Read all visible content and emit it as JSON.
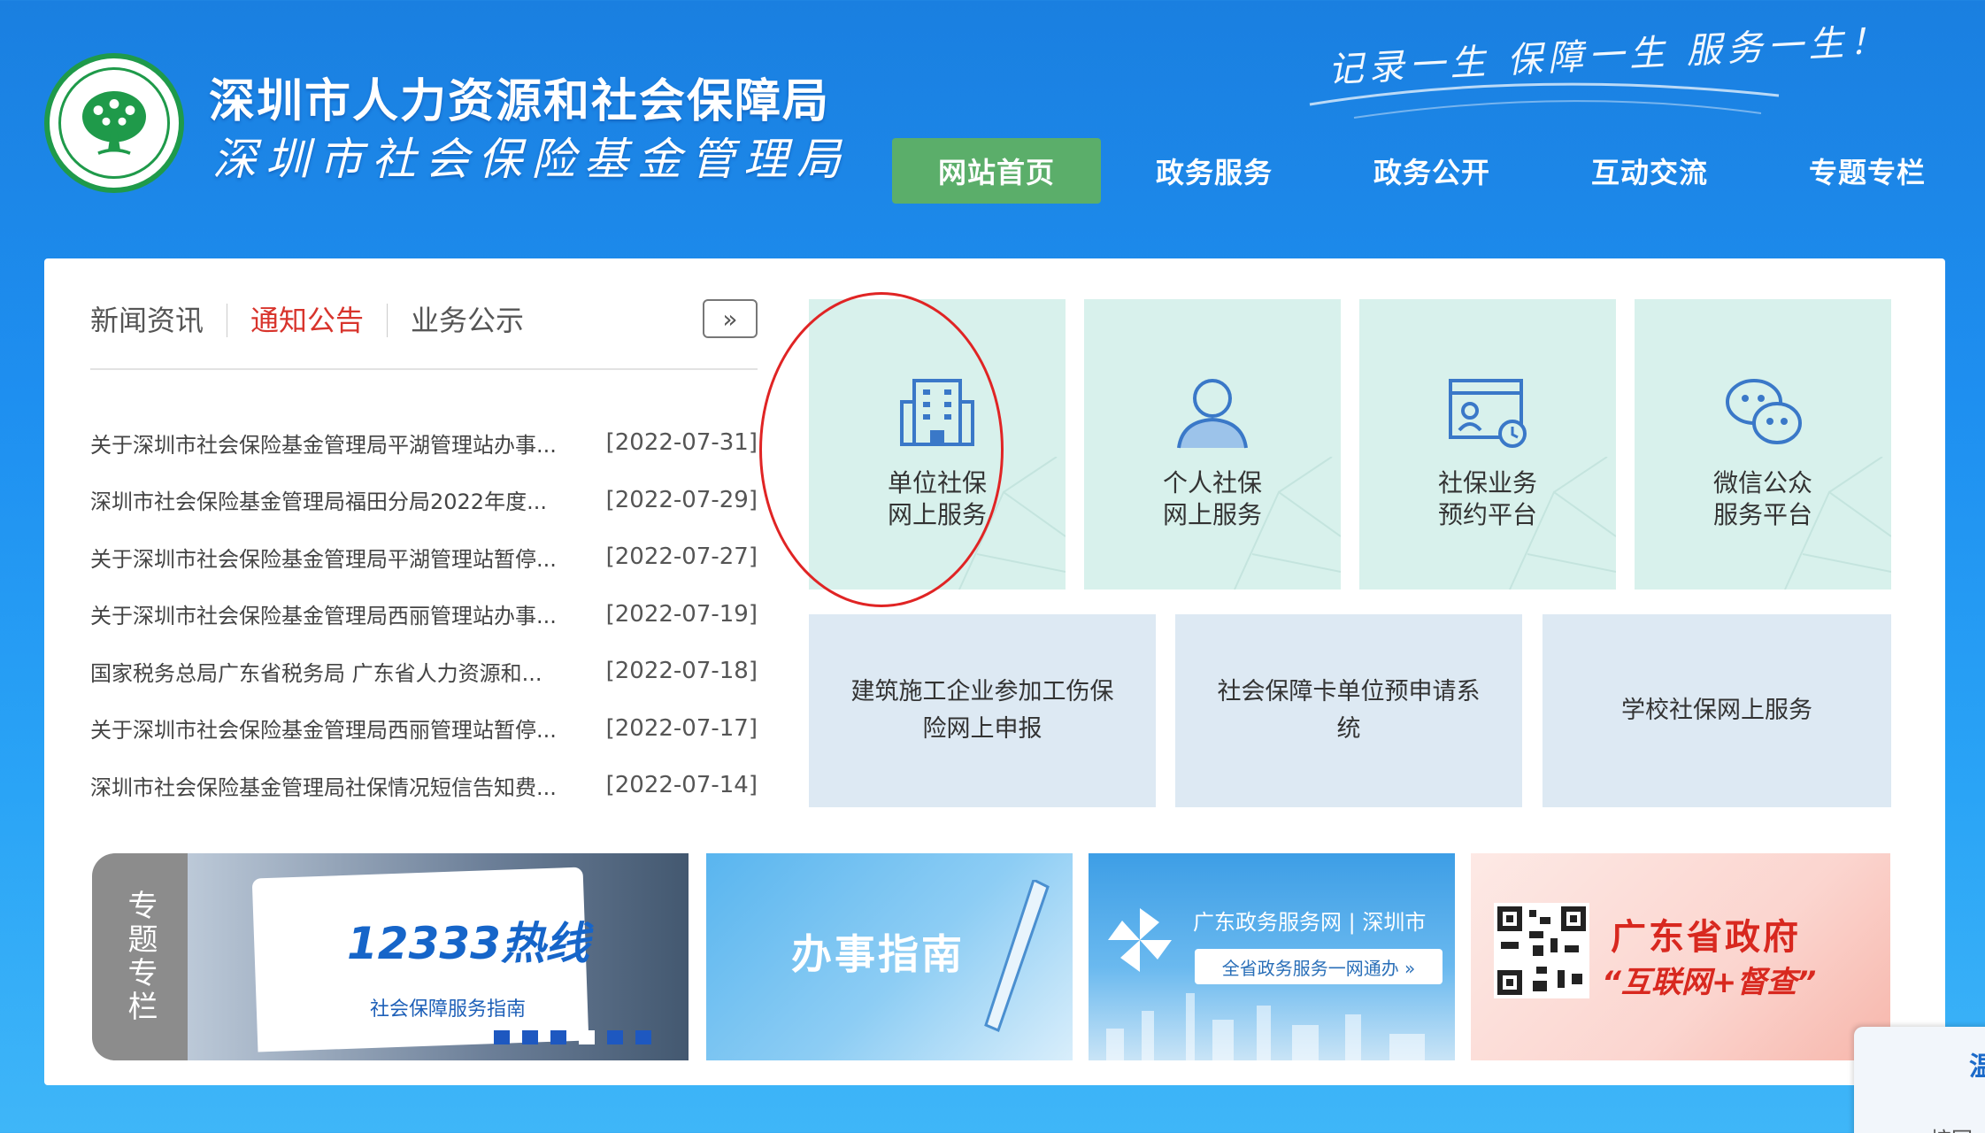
{
  "header": {
    "org_name_1": "深圳市人力资源和社会保障局",
    "org_name_2": "深圳市社会保险基金管理局",
    "slogan": "记录一生 保障一生 服务一生！",
    "logo_icon": "tree-emblem-icon"
  },
  "nav": [
    {
      "label": "网站首页",
      "active": true
    },
    {
      "label": "政务服务"
    },
    {
      "label": "政务公开"
    },
    {
      "label": "互动交流"
    },
    {
      "label": "专题专栏"
    }
  ],
  "news_tabs": [
    {
      "label": "新闻资讯"
    },
    {
      "label": "通知公告",
      "active": true
    },
    {
      "label": "业务公示"
    }
  ],
  "more_label": "»",
  "news": [
    {
      "title": "关于深圳市社会保险基金管理局平湖管理站办事...",
      "date": "[2022-07-31]"
    },
    {
      "title": "深圳市社会保险基金管理局福田分局2022年度...",
      "date": "[2022-07-29]"
    },
    {
      "title": "关于深圳市社会保险基金管理局平湖管理站暂停...",
      "date": "[2022-07-27]"
    },
    {
      "title": "关于深圳市社会保险基金管理局西丽管理站办事...",
      "date": "[2022-07-19]"
    },
    {
      "title": "国家税务总局广东省税务局 广东省人力资源和...",
      "date": "[2022-07-18]"
    },
    {
      "title": "关于深圳市社会保险基金管理局西丽管理站暂停...",
      "date": "[2022-07-17]"
    },
    {
      "title": "深圳市社会保险基金管理局社保情况短信告知费...",
      "date": "[2022-07-14]"
    }
  ],
  "services": [
    {
      "line1": "单位社保",
      "line2": "网上服务",
      "icon": "building-icon"
    },
    {
      "line1": "个人社保",
      "line2": "网上服务",
      "icon": "person-icon"
    },
    {
      "line1": "社保业务",
      "line2": "预约平台",
      "icon": "appointment-card-icon"
    },
    {
      "line1": "微信公众",
      "line2": "服务平台",
      "icon": "wechat-icon"
    }
  ],
  "services2": [
    {
      "label": "建筑施工企业参加工伤保险网上申报"
    },
    {
      "label": "社会保障卡单位预申请系统"
    },
    {
      "label": "学校社保网上服务"
    }
  ],
  "special": {
    "side_label": "专题专栏",
    "hotline_title": "12333热线",
    "hotline_sub": "社会保障服务指南",
    "guide": "办事指南",
    "gd_portal": "广东政务服务网 | 深圳市",
    "gd_portal_sub": "全省政务服务一网通办 »",
    "gd_gov_1": "广东省政府",
    "gd_gov_2": "“互联网+督查”"
  },
  "float_card": {
    "title": "温",
    "sub": "按回"
  },
  "colors": {
    "nav_active": "#5bae6a",
    "tab_active": "#d8342c",
    "tile_bg": "#d8f1ec",
    "tile2_bg": "#dde9f3"
  }
}
